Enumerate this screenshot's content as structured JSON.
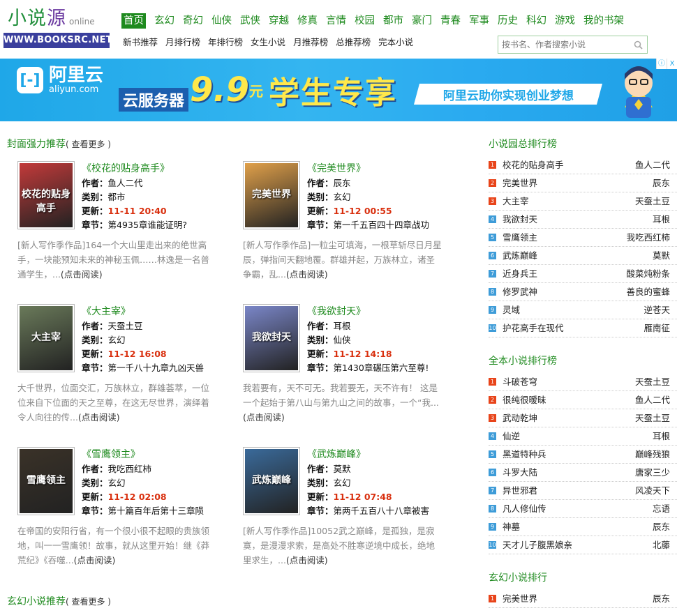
{
  "logo": {
    "name_left": "小说",
    "name_mid": "源",
    "online": "online",
    "domain": "WWW.BOOKSRC.NET"
  },
  "main_nav": [
    "首页",
    "玄幻",
    "奇幻",
    "仙侠",
    "武侠",
    "穿越",
    "修真",
    "言情",
    "校园",
    "都市",
    "豪门",
    "青春",
    "军事",
    "历史",
    "科幻",
    "游戏",
    "我的书架"
  ],
  "sub_nav": [
    "新书推荐",
    "月排行榜",
    "年排行榜",
    "女生小说",
    "月推荐榜",
    "总推荐榜",
    "完本小说"
  ],
  "search": {
    "placeholder": "按书名、作者搜索小说"
  },
  "banner": {
    "brand_cn": "阿里云",
    "brand_en": "aliyun.com",
    "server_label": "云服务器",
    "price": "9.9",
    "unit": "元",
    "headline": "学生专享",
    "slogan": "阿里云助你实现创业梦想",
    "ad_i": "ⓘ",
    "ad_x": "X"
  },
  "featured": {
    "title": "封面强力推荐",
    "more": "( 查看更多 )",
    "labels": {
      "author": "作者：",
      "category": "类别：",
      "updated": "更新：",
      "chapter": "章节：",
      "read": "(点击阅读)"
    },
    "books": [
      {
        "title": "《校花的贴身高手》",
        "author": "鱼人二代",
        "category": "都市",
        "updated": "11-11 20:40",
        "chapter": "第4935章谁能证明?",
        "desc": "[新人写作季作品]164一个大山里走出来的绝世高手，一块能预知未来的神秘玉佩……林逸是一名普通学生，...",
        "cover_text": "校花的贴身高手",
        "cover_color": "#c23a3a"
      },
      {
        "title": "《完美世界》",
        "author": "辰东",
        "category": "玄幻",
        "updated": "11-12 00:55",
        "chapter": "第一千五百四十四章战功",
        "desc": "[新人写作季作品]一粒尘可填海，一根草斩尽日月星辰，弹指间天翻地覆。群雄并起，万族林立，诸圣争霸，乱...",
        "cover_text": "完美世界",
        "cover_color": "#e0a04a"
      },
      {
        "title": "《大主宰》",
        "author": "天蚕土豆",
        "category": "玄幻",
        "updated": "11-12 16:08",
        "chapter": "第一千八十九章九凶天兽",
        "desc": "大千世界，位面交汇，万族林立，群雄荟萃，一位位来自下位面的天之至尊，在这无尽世界，演绎着令人向往的传...",
        "cover_text": "大主宰",
        "cover_color": "#6a7a5a"
      },
      {
        "title": "《我欲封天》",
        "author": "耳根",
        "category": "仙侠",
        "updated": "11-12 14:18",
        "chapter": "第1430章碾压第六至尊!",
        "desc": "我若要有，天不可无。我若要无，天不许有！ 这是一个起始于第八山与第九山之间的故事，一个“我...",
        "cover_text": "我欲封天",
        "cover_color": "#7a86c8"
      },
      {
        "title": "《雪鹰领主》",
        "author": "我吃西红柿",
        "category": "玄幻",
        "updated": "11-12 02:08",
        "chapter": "第十篇百年后第十三章陨",
        "desc": "在帝国的安阳行省，有一个很小很不起眼的贵族领地，叫一一雪鹰领！故事，就从这里开始！继《莽荒纪》《吞噬...",
        "cover_text": "雪鹰领主",
        "cover_color": "#3a3228"
      },
      {
        "title": "《武炼巅峰》",
        "author": "莫默",
        "category": "玄幻",
        "updated": "11-12 07:48",
        "chapter": "第两千五百八十八章被害",
        "desc": "[新人写作季作品]10052武之巅峰，是孤独，是寂寞，是漫漫求索，是高处不胜寒逆境中成长，绝地里求生，...",
        "cover_text": "武炼巅峰",
        "cover_color": "#3a6a9a"
      }
    ]
  },
  "xuanhuan_section": {
    "title": "玄幻小说推荐",
    "more": "( 查看更多 )"
  },
  "ranks": [
    {
      "title": "小说园总排行榜",
      "items": [
        {
          "no": "1",
          "name": "校花的贴身高手",
          "author": "鱼人二代"
        },
        {
          "no": "2",
          "name": "完美世界",
          "author": "辰东"
        },
        {
          "no": "3",
          "name": "大主宰",
          "author": "天蚕土豆"
        },
        {
          "no": "4",
          "name": "我欲封天",
          "author": "耳根"
        },
        {
          "no": "5",
          "name": "雪鹰领主",
          "author": "我吃西红柿"
        },
        {
          "no": "6",
          "name": "武炼巅峰",
          "author": "莫默"
        },
        {
          "no": "7",
          "name": "近身兵王",
          "author": "酸菜炖粉条"
        },
        {
          "no": "8",
          "name": "修罗武神",
          "author": "善良的蜜蜂"
        },
        {
          "no": "9",
          "name": "灵域",
          "author": "逆苍天"
        },
        {
          "no": "10",
          "name": "护花高手在现代",
          "author": "雁南征"
        }
      ]
    },
    {
      "title": "全本小说排行榜",
      "items": [
        {
          "no": "1",
          "name": "斗破苍穹",
          "author": "天蚕土豆"
        },
        {
          "no": "2",
          "name": "很纯很暧昧",
          "author": "鱼人二代"
        },
        {
          "no": "3",
          "name": "武动乾坤",
          "author": "天蚕土豆"
        },
        {
          "no": "4",
          "name": "仙逆",
          "author": "耳根"
        },
        {
          "no": "5",
          "name": "黑道特种兵",
          "author": "巅峰残狼"
        },
        {
          "no": "6",
          "name": "斗罗大陆",
          "author": "唐家三少"
        },
        {
          "no": "7",
          "name": "异世邪君",
          "author": "风凌天下"
        },
        {
          "no": "8",
          "name": "凡人修仙传",
          "author": "忘语"
        },
        {
          "no": "9",
          "name": "神墓",
          "author": "辰东"
        },
        {
          "no": "10",
          "name": "天才儿子腹黑娘亲",
          "author": "北藤"
        }
      ]
    },
    {
      "title": "玄幻小说排行",
      "items": [
        {
          "no": "1",
          "name": "完美世界",
          "author": "辰东"
        }
      ]
    }
  ],
  "colors": {
    "accent_green": "#1e8a1e",
    "logo_bar": "#3a3f9d",
    "time_red": "#d9300f",
    "rank_red": "#e8441a",
    "rank_blue": "#3e9cd8"
  }
}
